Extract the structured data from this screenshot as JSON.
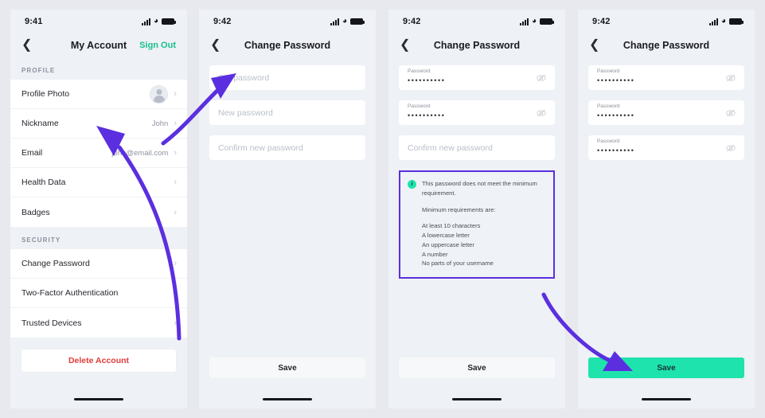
{
  "accent": {
    "teal": "#1fe3ac",
    "teal_text": "#17c08e",
    "purple": "#5b2fe0",
    "red": "#e03b3b"
  },
  "panel1": {
    "status": {
      "time": "9:41",
      "signal_icon": "cellular-bars-icon",
      "wifi_icon": "wifi-icon",
      "battery_icon": "battery-full-icon"
    },
    "nav": {
      "back_icon": "chevron-left-icon",
      "title": "My Account",
      "action": "Sign Out"
    },
    "sections": [
      {
        "header": "PROFILE",
        "rows": [
          {
            "label": "Profile Photo",
            "value": "",
            "accessory": "avatar"
          },
          {
            "label": "Nickname",
            "value": "John",
            "accessory": "chevron"
          },
          {
            "label": "Email",
            "value": "john@email.com",
            "accessory": "chevron"
          },
          {
            "label": "Health Data",
            "value": "",
            "accessory": "chevron"
          },
          {
            "label": "Badges",
            "value": "",
            "accessory": "chevron"
          }
        ]
      },
      {
        "header": "SECURITY",
        "rows": [
          {
            "label": "Change Password",
            "value": "",
            "accessory": "chevron"
          },
          {
            "label": "Two-Factor Authentication",
            "value": "",
            "accessory": "chevron"
          },
          {
            "label": "Trusted Devices",
            "value": "",
            "accessory": "chevron"
          }
        ]
      }
    ],
    "delete_button": "Delete Account"
  },
  "panel2": {
    "status": {
      "time": "9:42"
    },
    "nav": {
      "title": "Change Password"
    },
    "fields": [
      {
        "placeholder": "Old password",
        "value": "",
        "label": ""
      },
      {
        "placeholder": "New password",
        "value": "",
        "label": ""
      },
      {
        "placeholder": "Confirm new password",
        "value": "",
        "label": ""
      }
    ],
    "save": {
      "label": "Save",
      "state": "disabled"
    }
  },
  "panel3": {
    "status": {
      "time": "9:42"
    },
    "nav": {
      "title": "Change Password"
    },
    "fields": [
      {
        "placeholder": "",
        "value": "••••••••••",
        "label": "Password",
        "toggle_icon": "eye-slash-icon"
      },
      {
        "placeholder": "",
        "value": "••••••••••",
        "label": "Password",
        "toggle_icon": "eye-slash-icon"
      },
      {
        "placeholder": "Confirm new password",
        "value": "",
        "label": ""
      }
    ],
    "note": {
      "icon": "info-icon",
      "message": "This password does not meet the minimum requirement.",
      "subtitle": "Minimum requirements are:",
      "requirements": [
        "At least 10 characters",
        "A lowercase letter",
        "An uppercase letter",
        "A number",
        "No parts of your username"
      ]
    },
    "save": {
      "label": "Save",
      "state": "disabled"
    }
  },
  "panel4": {
    "status": {
      "time": "9:42"
    },
    "nav": {
      "title": "Change Password"
    },
    "fields": [
      {
        "placeholder": "",
        "value": "••••••••••",
        "label": "Password",
        "toggle_icon": "eye-slash-icon"
      },
      {
        "placeholder": "",
        "value": "••••••••••",
        "label": "Password",
        "toggle_icon": "eye-slash-icon"
      },
      {
        "placeholder": "",
        "value": "••••••••••",
        "label": "Password",
        "toggle_icon": "eye-slash-icon"
      }
    ],
    "save": {
      "label": "Save",
      "state": "active"
    }
  },
  "annotations": [
    {
      "name": "arrow-change-password-to-old-field",
      "color": "#5b2fe0"
    },
    {
      "name": "arrow-note-to-save-button",
      "color": "#5b2fe0"
    }
  ]
}
